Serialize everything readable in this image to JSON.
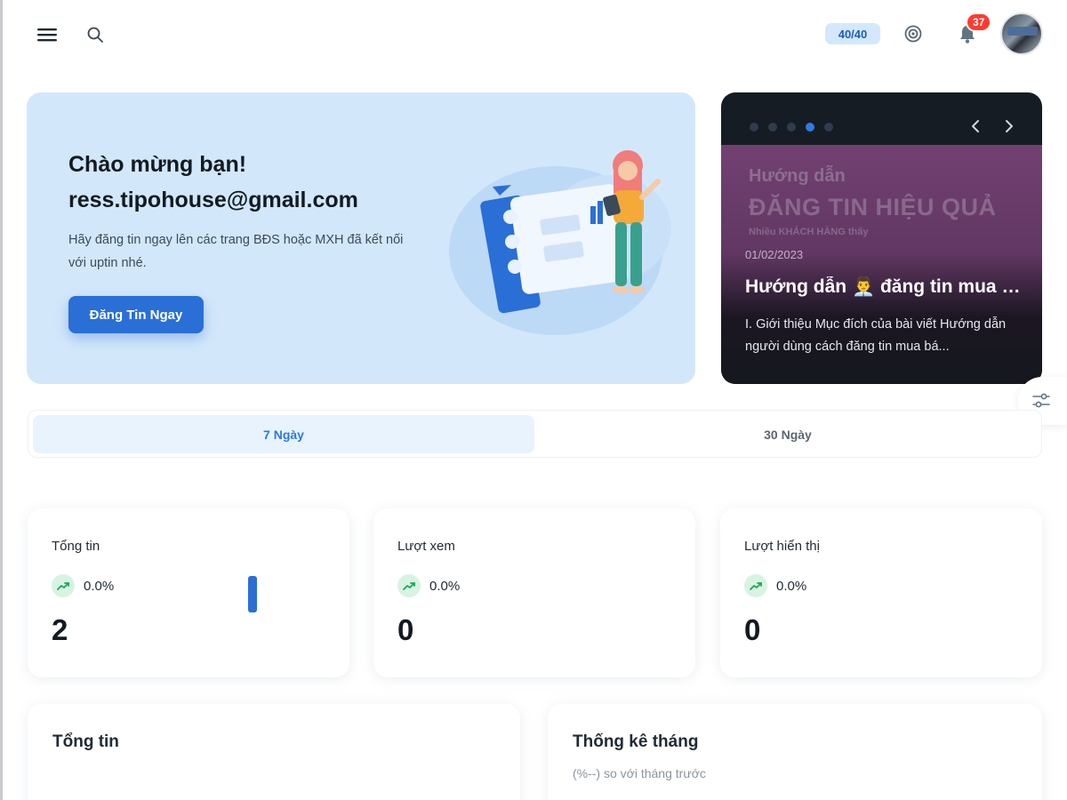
{
  "header": {
    "quota": "40/40",
    "notification_count": "37",
    "icons": [
      "menu-icon",
      "search-icon",
      "settings-icon",
      "bell-icon"
    ]
  },
  "welcome": {
    "greeting": "Chào mừng bạn!",
    "email": "ress.tipohouse@gmail.com",
    "description": "Hãy đăng tin ngay lên các trang BĐS hoặc MXH đã kết nối với uptin nhé.",
    "cta_label": "Đăng Tin Ngay"
  },
  "carousel": {
    "dot_count": 5,
    "active_dot": 4,
    "slide": {
      "bg_text_1": "Hướng dẫn",
      "bg_text_2": "ĐĂNG TIN HIỆU QUẢ",
      "bg_text_3": "Nhiều KHÁCH HÀNG thấy",
      "date": "01/02/2023",
      "title": "Hướng dẫn 👨‍💼 đăng tin mua bán",
      "excerpt": "I. Giới thiệu Mục đích của bài viết Hướng dẫn người dùng cách đăng tin mua bá..."
    }
  },
  "tabs": [
    {
      "label": "7 Ngày",
      "active": true
    },
    {
      "label": "30 Ngày",
      "active": false
    }
  ],
  "stats": [
    {
      "label": "Tổng tin",
      "percent": "0.0%",
      "value": "2",
      "spark_level": 1
    },
    {
      "label": "Lượt xem",
      "percent": "0.0%",
      "value": "0"
    },
    {
      "label": "Lượt hiển thị",
      "percent": "0.0%",
      "value": "0"
    }
  ],
  "panels": [
    {
      "title": "Tổng tin"
    },
    {
      "title": "Thống kê tháng",
      "subtitle": "(%--) so với tháng trước"
    }
  ],
  "colors": {
    "accent": "#2a6fd6",
    "welcome_bg": "#d3e7fb",
    "carousel_bg": "#161c24",
    "badge": "#ff3b30",
    "trend_bg": "#d8f3e2"
  }
}
